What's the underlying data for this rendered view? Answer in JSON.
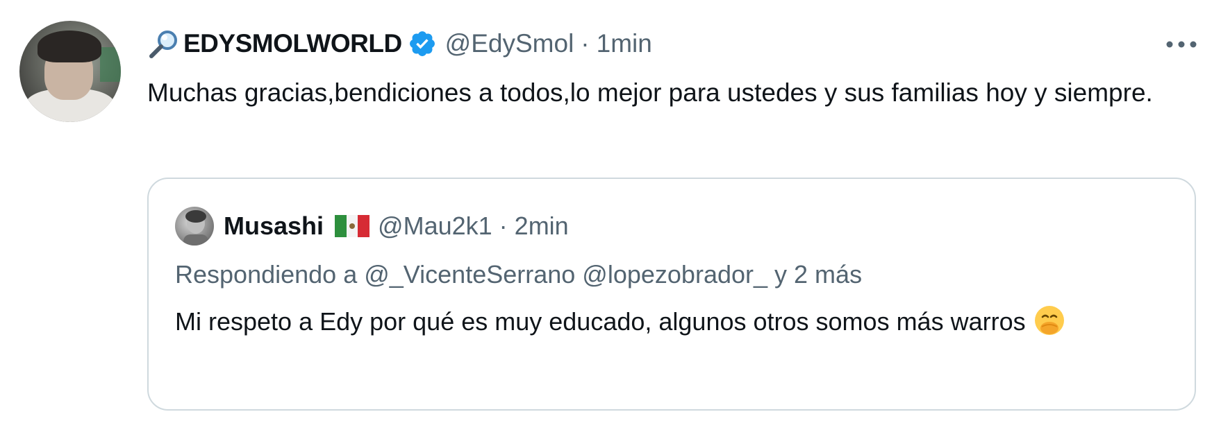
{
  "tweet": {
    "display_name": "EDYSMOLWORLD",
    "name_prefix_icon": "magnifying-glass-icon",
    "verified_icon": "verified-badge-icon",
    "handle": "@EdySmol",
    "separator": "·",
    "time": "1min",
    "more_icon": "more-options-icon",
    "text": "Muchas gracias,bendiciones a todos,lo mejor para ustedes y sus familias hoy y siempre."
  },
  "quoted": {
    "display_name": "Musashi",
    "flag_icon": "mexico-flag-icon",
    "handle": "@Mau2k1",
    "separator": "·",
    "time": "2min",
    "replying_prefix": "Respondiendo a",
    "replying_mentions": "@_VicenteSerrano @lopezobrador_",
    "replying_suffix": "y 2 más",
    "text": "Mi respeto a Edy por qué es muy educado, algunos otros somos más warros",
    "emoji": "face-with-hand-over-mouth-emoji"
  },
  "colors": {
    "text_primary": "#0f1419",
    "text_secondary": "#536471",
    "verified_blue": "#1d9bf0",
    "border": "#cfd9de"
  }
}
